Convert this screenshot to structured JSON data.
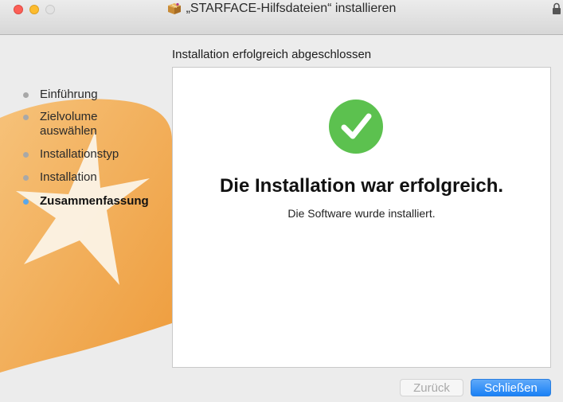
{
  "window": {
    "title": "„STARFACE-Hilfsdateien“ installieren"
  },
  "header": {
    "section_title": "Installation erfolgreich abgeschlossen"
  },
  "sidebar": {
    "steps": [
      {
        "label": "Einführung",
        "state": "done"
      },
      {
        "label": "Zielvolume\nauswählen",
        "state": "done"
      },
      {
        "label": "Installationstyp",
        "state": "done"
      },
      {
        "label": "Installation",
        "state": "done"
      },
      {
        "label": "Zusammenfassung",
        "state": "active"
      }
    ]
  },
  "main": {
    "headline": "Die Installation war erfolgreich.",
    "subline": "Die Software wurde installiert.",
    "status_icon": "checkmark-success-icon"
  },
  "buttons": {
    "back_label": "Zurück",
    "close_label": "Schließen"
  },
  "colors": {
    "success_green": "#5cc14f",
    "primary_blue": "#1a81f5",
    "active_step_dot": "#5aa7ea",
    "background_art_orange": "#f1a64a"
  }
}
